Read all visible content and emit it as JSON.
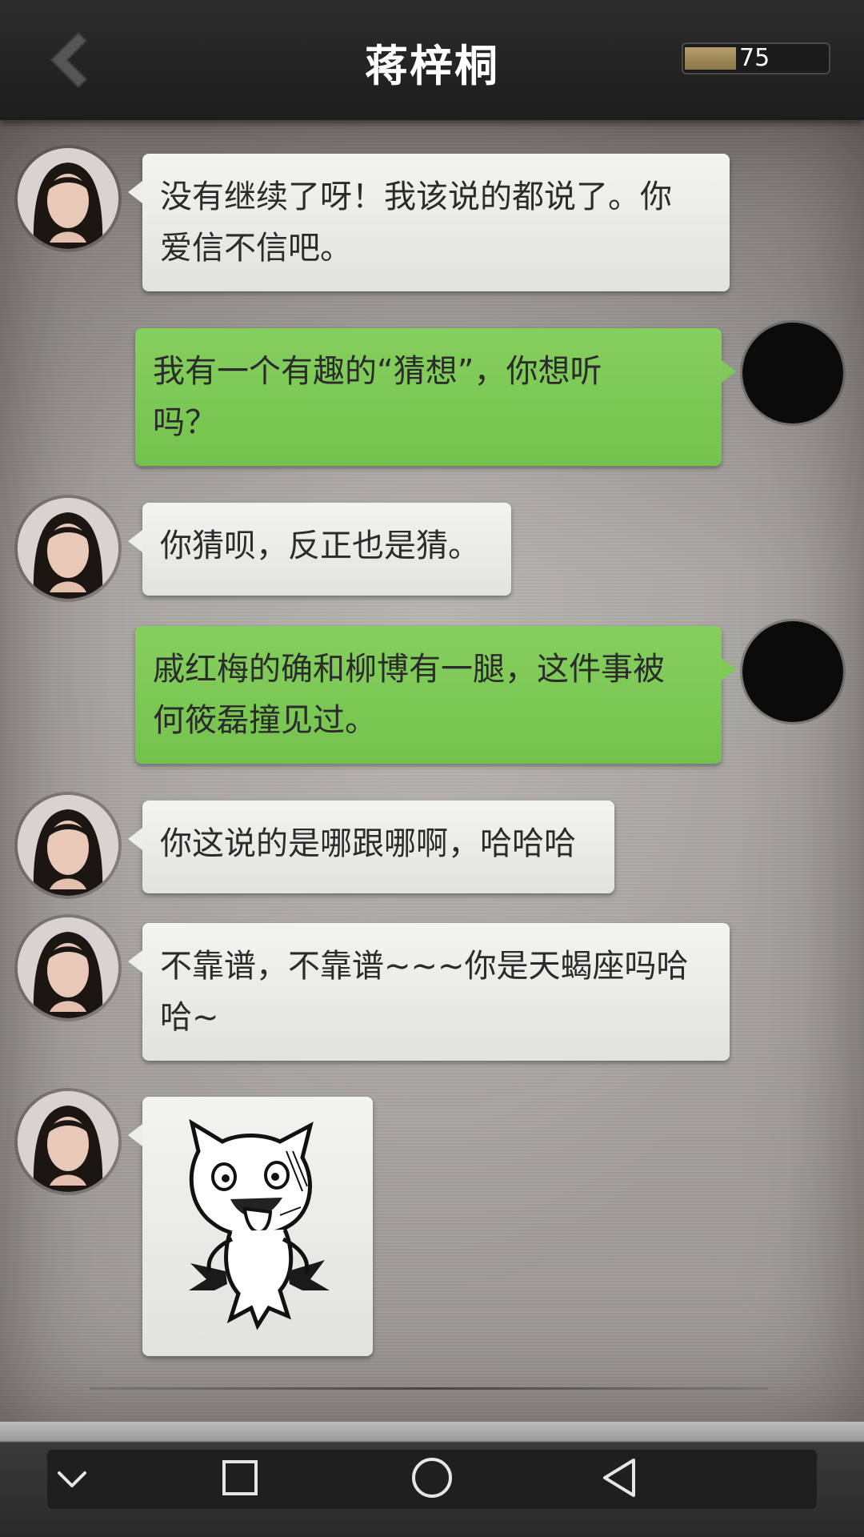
{
  "header": {
    "title": "蒋梓桐",
    "meter_value": "75",
    "meter_fraction": 0.36
  },
  "messages": [
    {
      "side": "left",
      "text": "没有继续了呀！我该说的都说了。你爱信不信吧。",
      "lines": [
        "没有继续了呀！我该说的都说了。你",
        "爱信不信吧。"
      ]
    },
    {
      "side": "right",
      "lines": [
        "我有一个有趣的“猜想”，你想听",
        "吗？"
      ]
    },
    {
      "side": "left",
      "lines": [
        "你猜呗，反正也是猜。"
      ]
    },
    {
      "side": "right",
      "lines": [
        "戚红梅的确和柳博有一腿，这件事被",
        "何筱磊撞见过。"
      ]
    },
    {
      "side": "left",
      "lines": [
        "你这说的是哪跟哪啊，哈哈哈"
      ]
    },
    {
      "side": "left",
      "lines": [
        "不靠谱，不靠谱~~~你是天蝎座吗哈",
        "哈~"
      ]
    },
    {
      "side": "left",
      "type": "sticker",
      "sticker": "cat-demon-sticker"
    }
  ],
  "icons": {
    "back": "back-chevron-icon",
    "nav_down": "chevron-down-icon",
    "nav_recent": "square-icon",
    "nav_home": "circle-icon",
    "nav_back": "triangle-back-icon"
  },
  "colors": {
    "header_bg": "#232323",
    "bubble_left": "#ececea",
    "bubble_right": "#7dc955",
    "meter_fill": "#a08a5a"
  }
}
